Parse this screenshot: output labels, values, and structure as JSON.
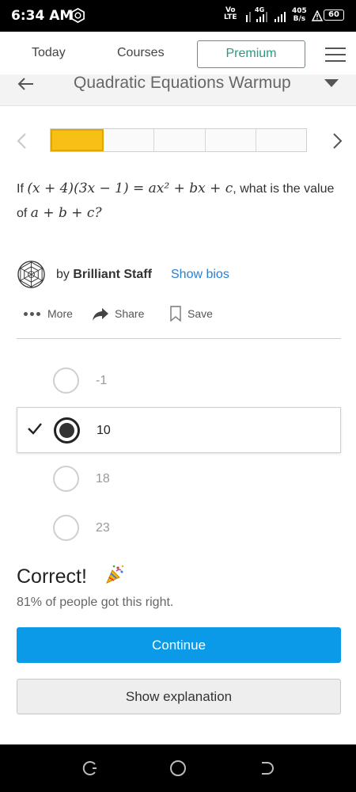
{
  "status_bar": {
    "time": "6:34 AM",
    "volte_top": "Vo",
    "volte_bottom": "LTE",
    "network": "4G",
    "speed_value": "405",
    "speed_unit": "B/s",
    "battery": "60",
    "app_icon": "hexagon-app-icon",
    "alert_icon": "warning-triangle-icon"
  },
  "nav": {
    "tabs": [
      "Today",
      "Courses"
    ],
    "premium_label": "Premium",
    "menu_icon": "hamburger-icon"
  },
  "title_bar": {
    "title": "Quadratic Equations Warmup",
    "back_icon": "arrow-left-icon",
    "dropdown_icon": "caret-down-icon"
  },
  "progress": {
    "segments_total": 5,
    "segments_completed": 1,
    "prev_icon": "chevron-left-icon",
    "next_icon": "chevron-right-icon"
  },
  "question": {
    "prefix": "If ",
    "expression": "(x + 4)(3x − 1) = ax² + bx + c",
    "middle": ", what is the value of ",
    "target": "a + b + c",
    "suffix": "?"
  },
  "author": {
    "by_label": "by",
    "name": "Brilliant Staff",
    "bios_link": "Show bios",
    "logo_icon": "geodesic-logo-icon"
  },
  "actions": {
    "more_label": "More",
    "share_label": "Share",
    "save_label": "Save"
  },
  "options": [
    {
      "label": "-1",
      "selected": false
    },
    {
      "label": "10",
      "selected": true
    },
    {
      "label": "18",
      "selected": false
    },
    {
      "label": "23",
      "selected": false
    }
  ],
  "result": {
    "heading": "Correct!",
    "icon": "party-popper-icon",
    "stat": "81% of people got this right."
  },
  "buttons": {
    "continue": "Continue",
    "explanation": "Show explanation"
  },
  "colors": {
    "accent_blue": "#0a9ae8",
    "premium_green": "#2b9a80",
    "progress_yellow": "#f6c015",
    "link_blue": "#2a7fcf"
  }
}
